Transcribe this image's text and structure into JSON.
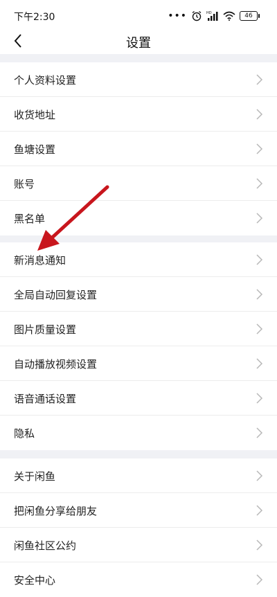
{
  "status_bar": {
    "time": "下午2:30",
    "dots": "•••",
    "battery": "46"
  },
  "header": {
    "title": "设置",
    "back_icon": "back-chevron-icon"
  },
  "sections": [
    {
      "items": [
        {
          "label": "个人资料设置"
        },
        {
          "label": "收货地址"
        },
        {
          "label": "鱼塘设置"
        },
        {
          "label": "账号"
        },
        {
          "label": "黑名单"
        }
      ]
    },
    {
      "items": [
        {
          "label": "新消息通知"
        },
        {
          "label": "全局自动回复设置"
        },
        {
          "label": "图片质量设置"
        },
        {
          "label": "自动播放视频设置"
        },
        {
          "label": "语音通话设置"
        },
        {
          "label": "隐私"
        }
      ]
    },
    {
      "items": [
        {
          "label": "关于闲鱼"
        },
        {
          "label": "把闲鱼分享给朋友"
        },
        {
          "label": "闲鱼社区公约"
        },
        {
          "label": "安全中心"
        }
      ]
    }
  ],
  "colors": {
    "background": "#ffffff",
    "section_gap": "#f0f1f5",
    "annotation_arrow": "#c8161d"
  }
}
